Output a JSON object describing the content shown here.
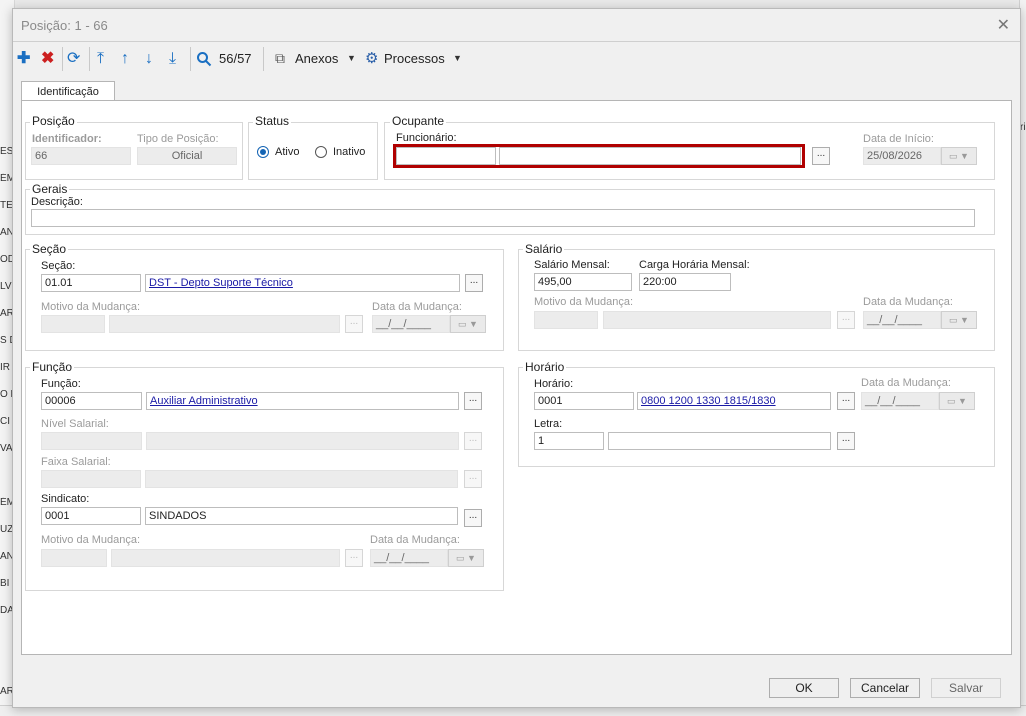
{
  "background": {
    "fragments": [
      "ES",
      "ÉM",
      "TES",
      "AN",
      "OD",
      "LV",
      "ARI",
      "S D",
      "IR",
      "O E",
      "CI",
      "VA",
      "ÉM",
      "UZ",
      "AN",
      "BI",
      "DA",
      "ARI"
    ],
    "right_fragment": "ria"
  },
  "dialog": {
    "title": "Posição: 1 - 66",
    "close_label": "✕"
  },
  "toolbar": {
    "add_icon": "plus-icon",
    "delete_icon": "x-icon",
    "refresh_icon": "refresh-icon",
    "first_icon": "arrow-up-bar-icon",
    "prev_icon": "arrow-up-icon",
    "next_icon": "arrow-down-icon",
    "last_icon": "arrow-down-bar-icon",
    "search_icon": "search-icon",
    "record_counter": "56/57",
    "attachments_label": "Anexos",
    "processes_label": "Processos"
  },
  "tab": {
    "label": "Identificação"
  },
  "posicao": {
    "title": "Posição",
    "identificador_label": "Identificador:",
    "identificador_value": "66",
    "tipo_label": "Tipo de Posição:",
    "tipo_value": "Oficial"
  },
  "status": {
    "title": "Status",
    "ativo_label": "Ativo",
    "inativo_label": "Inativo"
  },
  "ocupante": {
    "title": "Ocupante",
    "funcionario_label": "Funcionário:",
    "funcionario_code": "",
    "funcionario_name": "",
    "data_inicio_label": "Data de Início:",
    "data_inicio_value": "25/08/2026"
  },
  "gerais": {
    "title": "Gerais",
    "descricao_label": "Descrição:",
    "descricao_value": ""
  },
  "secao": {
    "title": "Seção",
    "secao_label": "Seção:",
    "secao_code": "01.01",
    "secao_name": "DST - Depto Suporte Técnico",
    "motivo_label": "Motivo da Mudança:",
    "data_label": "Data da Mudança:",
    "data_value": "__/__/____"
  },
  "salario": {
    "title": "Salário",
    "mensal_label": "Salário Mensal:",
    "mensal_value": "495,00",
    "carga_label": "Carga Horária Mensal:",
    "carga_value": "220:00",
    "motivo_label": "Motivo da Mudança:",
    "data_label": "Data da Mudança:",
    "data_value": "__/__/____"
  },
  "funcao": {
    "title": "Função",
    "funcao_label": "Função:",
    "funcao_code": "00006",
    "funcao_name": "Auxiliar Administrativo",
    "nivel_label": "Nível Salarial:",
    "faixa_label": "Faixa Salarial:",
    "sindicato_label": "Sindicato:",
    "sindicato_code": "0001",
    "sindicato_name": "SINDADOS",
    "motivo_label": "Motivo da Mudança:",
    "data_label": "Data da Mudança:",
    "data_value": "__/__/____"
  },
  "horario": {
    "title": "Horário",
    "horario_label": "Horário:",
    "horario_code": "0001",
    "horario_name": "0800 1200 1330 1815/1830",
    "data_label": "Data da Mudança:",
    "data_value": "__/__/____",
    "letra_label": "Letra:",
    "letra_value": "1"
  },
  "buttons": {
    "ok": "OK",
    "cancel": "Cancelar",
    "save": "Salvar",
    "dots": "..."
  },
  "colors": {
    "highlight": "#b00000",
    "accent": "#1464b4",
    "link": "#1a1aa6"
  }
}
